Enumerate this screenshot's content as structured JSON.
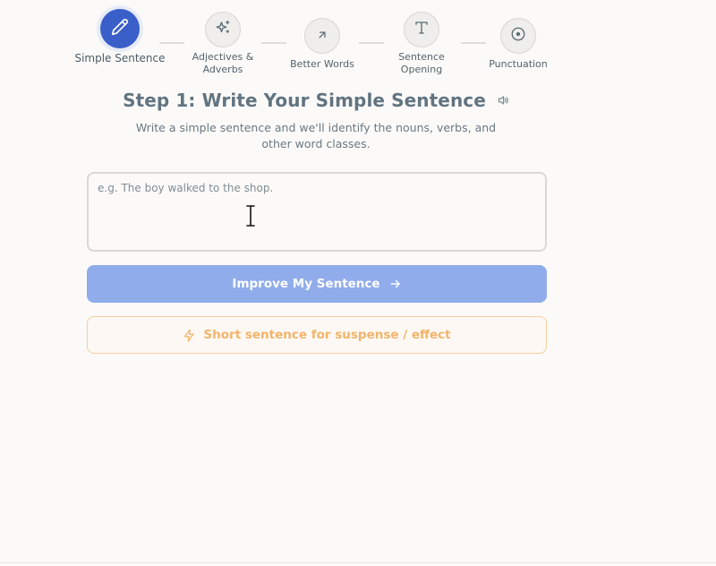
{
  "stepper": {
    "steps": [
      {
        "label": "Simple Sentence",
        "icon": "pencil-icon",
        "active": true
      },
      {
        "label": "Adjectives & Adverbs",
        "icon": "sparkle-icon",
        "active": false
      },
      {
        "label": "Better Words",
        "icon": "arrow-up-right-icon",
        "active": false
      },
      {
        "label": "Sentence Opening",
        "icon": "type-icon",
        "active": false
      },
      {
        "label": "Punctuation",
        "icon": "target-icon",
        "active": false
      }
    ]
  },
  "main": {
    "heading": "Step 1: Write Your Simple Sentence",
    "subtitle": "Write a simple sentence and we'll identify the nouns, verbs, and other word classes.",
    "input": {
      "placeholder": "e.g. The boy walked to the shop.",
      "value": ""
    },
    "primary_button": "Improve My Sentence",
    "secondary_button": "Short sentence for suspense / effect"
  },
  "colors": {
    "accent": "#3b5fc9",
    "primary_button": "#90aceb",
    "secondary_border": "#f7cf9d",
    "secondary_text": "#f2b46a",
    "heading": "#627480"
  }
}
